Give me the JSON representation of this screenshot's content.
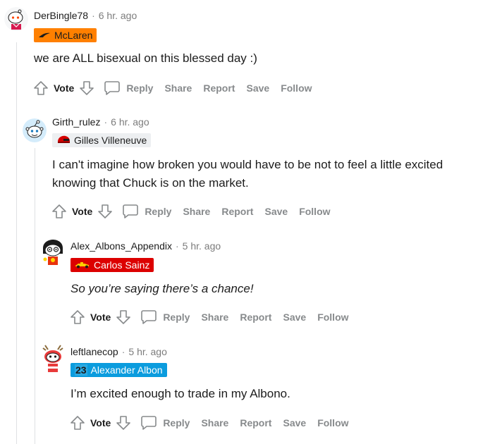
{
  "actions": {
    "vote": "Vote",
    "reply": "Reply",
    "share": "Share",
    "report": "Report",
    "save": "Save",
    "follow": "Follow"
  },
  "comments": [
    {
      "username": "DerBingle78",
      "time": "6 hr. ago",
      "flair": "McLaren",
      "flair_icon": "mclaren-swoosh-icon",
      "flair_bg": "#ff8000",
      "flair_color": "#1c1c1c",
      "body": "we are ALL bisexual on this blessed day :)"
    },
    {
      "username": "Girth_rulez",
      "time": "6 hr. ago",
      "flair": "Gilles Villeneuve",
      "flair_icon": "helmet-icon",
      "flair_bg": "#edeff1",
      "flair_color": "#1c1c1c",
      "body": "I can't imagine how broken you would have to be not to feel a little excited knowing that Chuck is on the market."
    },
    {
      "username": "Alex_Albons_Appendix",
      "time": "5 hr. ago",
      "flair": "Carlos Sainz",
      "flair_icon": "ferrari-car-icon",
      "flair_bg": "#dc0000",
      "flair_color": "#ffffff",
      "body": "So you’re saying there’s a chance!"
    },
    {
      "username": "leftlanecop",
      "time": "5 hr. ago",
      "flair": "Alexander Albon",
      "flair_number": "23",
      "flair_icon": "number-23-badge",
      "flair_bg": "#0b9cde",
      "flair_color": "#ffffff",
      "body": "I’m excited enough to trade in my Albono."
    }
  ]
}
